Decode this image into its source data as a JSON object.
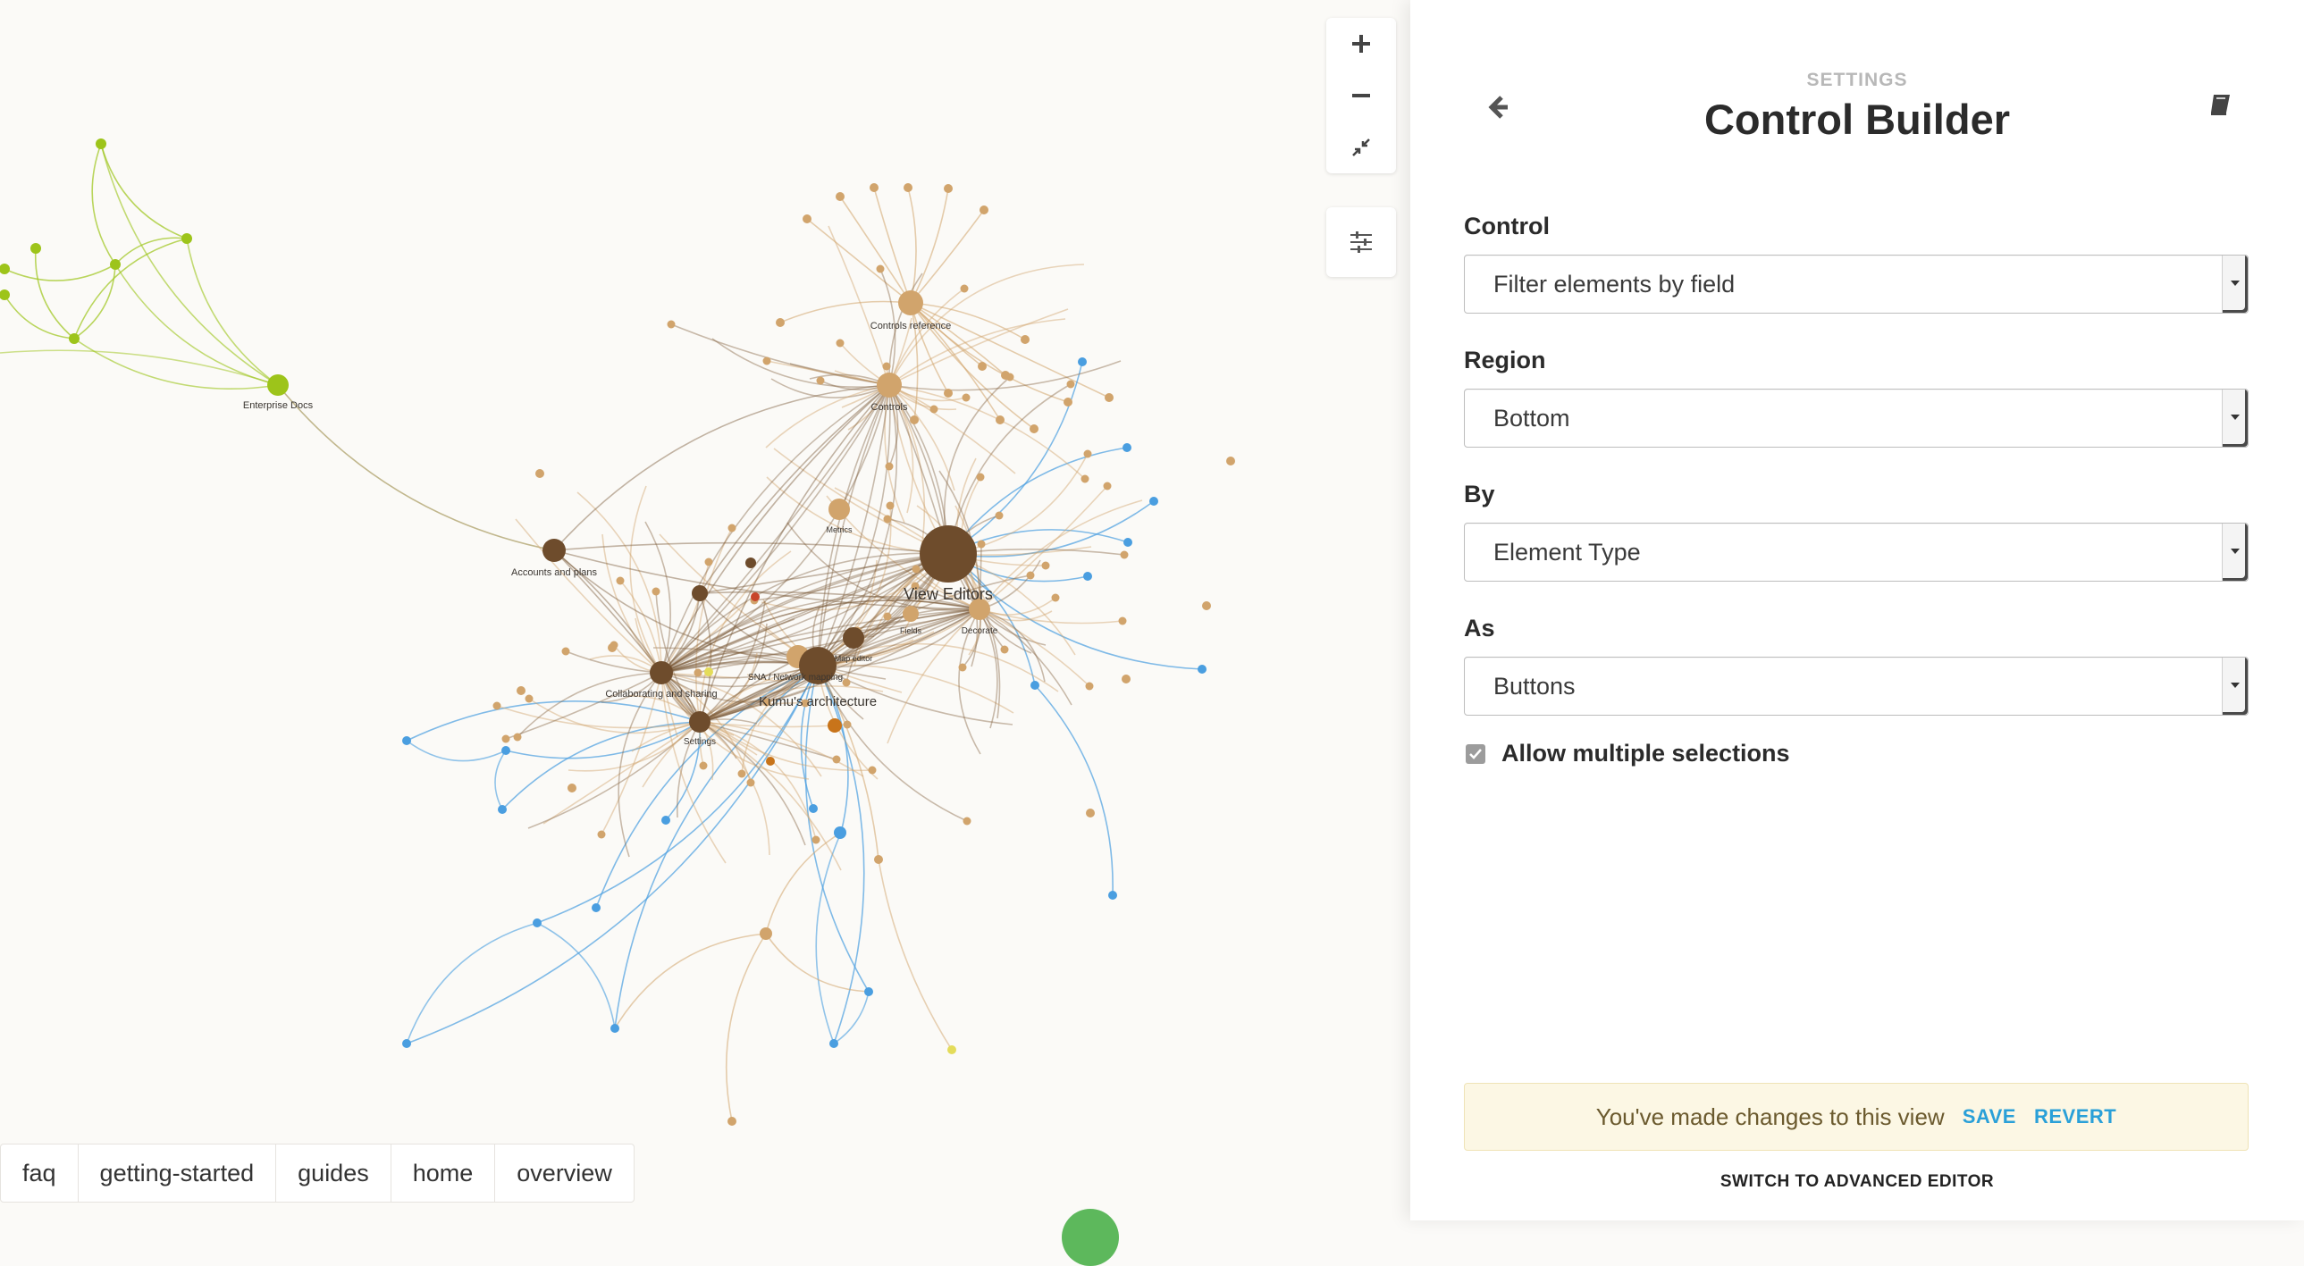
{
  "map": {
    "labels": {
      "enterprise_docs": "Enterprise Docs",
      "controls_reference": "Controls reference",
      "controls": "Controls",
      "accounts_and_plans": "Accounts and plans",
      "view_editors": "View Editors",
      "metrics": "Metrics",
      "fields": "Fields",
      "decorate": "Decorate",
      "settings": "Settings",
      "collaborating_and_sharing": "Collaborating and sharing",
      "sna_network_mapping": "SNA / Network mapping",
      "kumus_architecture": "Kumu's architecture",
      "map_editor": "Map editor"
    },
    "colors": {
      "brown": "#6e4c2c",
      "tan": "#d1a46c",
      "blue": "#4a9ee0",
      "green": "#9dc41a",
      "yellow": "#e4dc5a",
      "red": "#c8452a",
      "orange": "#c8741a"
    }
  },
  "map_controls": {
    "zoom_in_icon": "plus-icon",
    "zoom_out_icon": "minus-icon",
    "fit_icon": "compress-icon",
    "settings_icon": "sliders-icon"
  },
  "tags": [
    "faq",
    "getting-started",
    "guides",
    "home",
    "overview"
  ],
  "panel": {
    "kicker": "SETTINGS",
    "title": "Control Builder",
    "control_label": "Control",
    "control_value": "Filter elements by field",
    "region_label": "Region",
    "region_value": "Bottom",
    "by_label": "By",
    "by_value": "Element Type",
    "as_label": "As",
    "as_value": "Buttons",
    "allow_multiple_label": "Allow multiple selections",
    "allow_multiple_checked": true,
    "notice_text": "You've made changes to this view",
    "save_label": "SAVE",
    "revert_label": "REVERT",
    "advanced_label": "SWITCH TO ADVANCED EDITOR"
  }
}
